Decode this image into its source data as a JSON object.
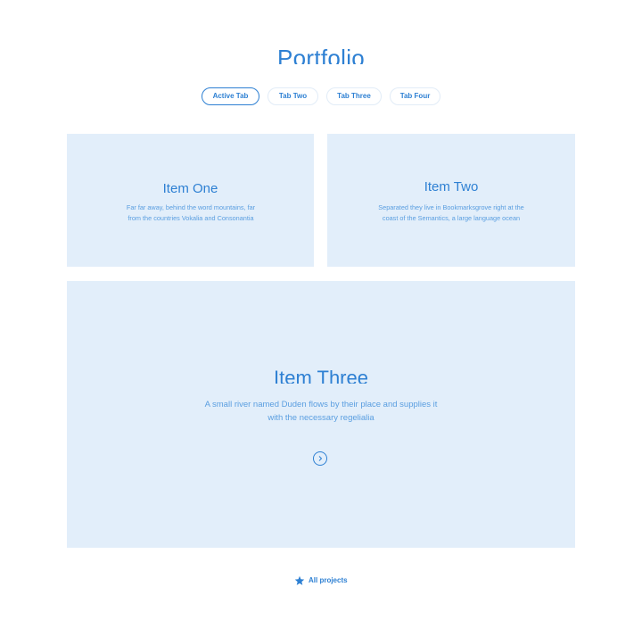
{
  "page": {
    "title": "Portfolio"
  },
  "tabs": [
    {
      "label": "Active Tab",
      "active": true
    },
    {
      "label": "Tab Two",
      "active": false
    },
    {
      "label": "Tab Three",
      "active": false
    },
    {
      "label": "Tab Four",
      "active": false
    }
  ],
  "items": [
    {
      "title": "Item One",
      "description_line1": "Far far away, behind the word mountains, far",
      "description_line2": "from the countries Vokalia and Consonantia"
    },
    {
      "title": "Item Two",
      "description_line1": "Separated they live in Bookmarksgrove right at the",
      "description_line2": "coast of the Semantics, a large language ocean"
    },
    {
      "title": "Item Three",
      "description_line1": "A small river named Duden flows by their place and supplies it",
      "description_line2": "with the necessary regelialia",
      "action_icon": "chevron-right-icon"
    }
  ],
  "footer": {
    "link_label": "All projects",
    "link_icon": "star-icon"
  },
  "colors": {
    "accent": "#2e80d3",
    "card_bg": "#e2eefa",
    "text_light": "#5a9ee0",
    "tab_border": "#e1ecf7"
  }
}
